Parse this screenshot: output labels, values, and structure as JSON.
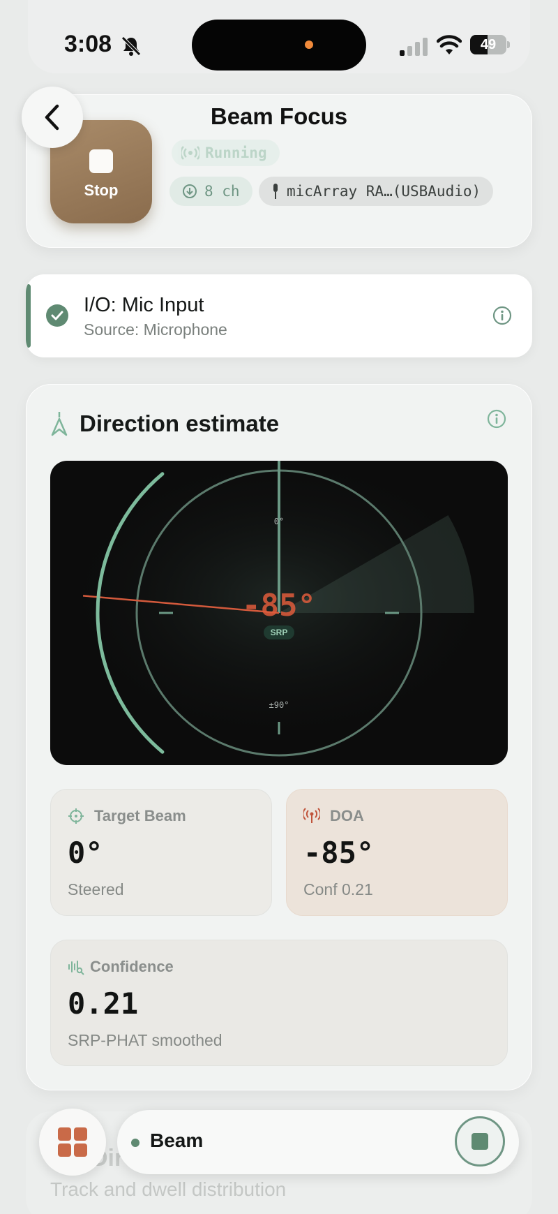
{
  "status_bar": {
    "time": "3:08",
    "battery": "49",
    "battery_level": 0.49
  },
  "header": {
    "title": "Beam Focus",
    "stop_label": "Stop",
    "state": "Running",
    "channels": "8 ch",
    "device": "micArray RA…(USBAudio)"
  },
  "io": {
    "title": "I/O: Mic Input",
    "source": "Source: Microphone"
  },
  "direction": {
    "title": "Direction estimate",
    "readout": "-85°",
    "badge": "SRP",
    "tick_top": "0°",
    "tick_bottom": "±90°",
    "doa_deg": -85,
    "target_deg": 0,
    "confidence": 0.21
  },
  "metrics": {
    "target": {
      "label": "Target Beam",
      "value": "0°",
      "sub": "Steered"
    },
    "doa": {
      "label": "DOA",
      "value": "-85°",
      "sub": "Conf 0.21"
    },
    "confidence": {
      "label": "Confidence",
      "value": "0.21",
      "sub": "SRP-PHAT smoothed"
    }
  },
  "ghost_section": {
    "title": "Direction over time",
    "subtitle": "Track and dwell distribution"
  },
  "bottom_nav": {
    "label": "Beam"
  },
  "colors": {
    "accent": "#5f8a72",
    "stop_brown": "#9a7b5b",
    "doa_orange": "#e05c3c"
  }
}
